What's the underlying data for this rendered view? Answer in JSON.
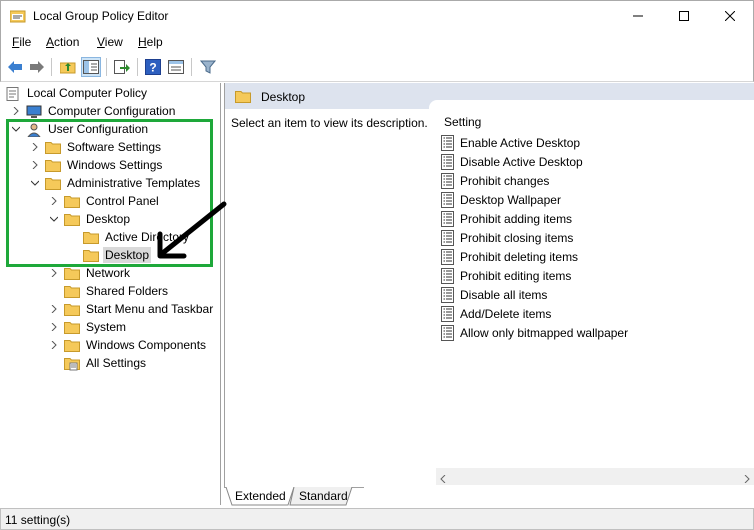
{
  "window": {
    "title": "Local Group Policy Editor"
  },
  "menu": [
    {
      "label": "File",
      "hotkey": "F"
    },
    {
      "label": "Action",
      "hotkey": "A"
    },
    {
      "label": "View",
      "hotkey": "V"
    },
    {
      "label": "Help",
      "hotkey": "H"
    }
  ],
  "tree": {
    "root": "Local Computer Policy",
    "computer_configuration": "Computer Configuration",
    "user_configuration": "User Configuration",
    "software_settings": "Software Settings",
    "windows_settings": "Windows Settings",
    "administrative_templates": "Administrative Templates",
    "control_panel": "Control Panel",
    "desktop": "Desktop",
    "active_directory": "Active Directory",
    "desktop_selected": "Desktop",
    "network": "Network",
    "shared_folders": "Shared Folders",
    "start_menu": "Start Menu and Taskbar",
    "system": "System",
    "windows_components": "Windows Components",
    "all_settings": "All Settings"
  },
  "details": {
    "header_title": "Desktop",
    "description": "Select an item to view its description.",
    "column_setting": "Setting",
    "settings": [
      "Enable Active Desktop",
      "Disable Active Desktop",
      "Prohibit changes",
      "Desktop Wallpaper",
      "Prohibit adding items",
      "Prohibit closing items",
      "Prohibit deleting items",
      "Prohibit editing items",
      "Disable all items",
      "Add/Delete items",
      "Allow only bitmapped wallpaper"
    ]
  },
  "tabs": {
    "extended": "Extended",
    "standard": "Standard"
  },
  "status": {
    "text": "11 setting(s)"
  },
  "colors": {
    "annotation_green": "#1ea83a",
    "header_bg": "#dde3ee",
    "folder_yellow": "#f5c95a"
  }
}
